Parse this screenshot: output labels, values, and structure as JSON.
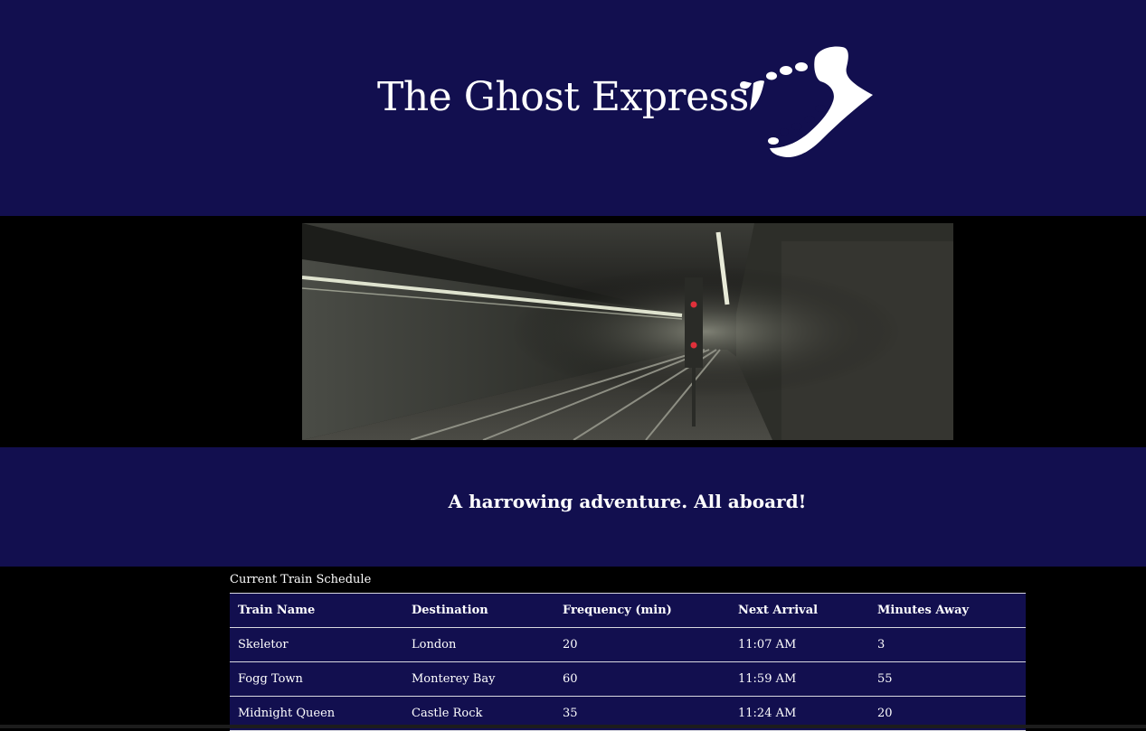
{
  "header": {
    "title": "The Ghost Express",
    "logo_icon": "jawbone-teeth-logo-icon"
  },
  "banner": {
    "image": "subway-tunnel-image"
  },
  "tagline": "A harrowing adventure. All aboard!",
  "schedule": {
    "caption": "Current Train Schedule",
    "columns": [
      "Train Name",
      "Destination",
      "Frequency (min)",
      "Next Arrival",
      "Minutes Away"
    ],
    "rows": [
      [
        "Skeletor",
        "London",
        "20",
        "11:07 AM",
        "3"
      ],
      [
        "Fogg Town",
        "Monterey Bay",
        "60",
        "11:59 AM",
        "55"
      ],
      [
        "Midnight Queen",
        "Castle Rock",
        "35",
        "11:24 AM",
        "20"
      ]
    ]
  },
  "colors": {
    "navy": "#120f4f",
    "black": "#000000",
    "text": "#ffffff"
  }
}
